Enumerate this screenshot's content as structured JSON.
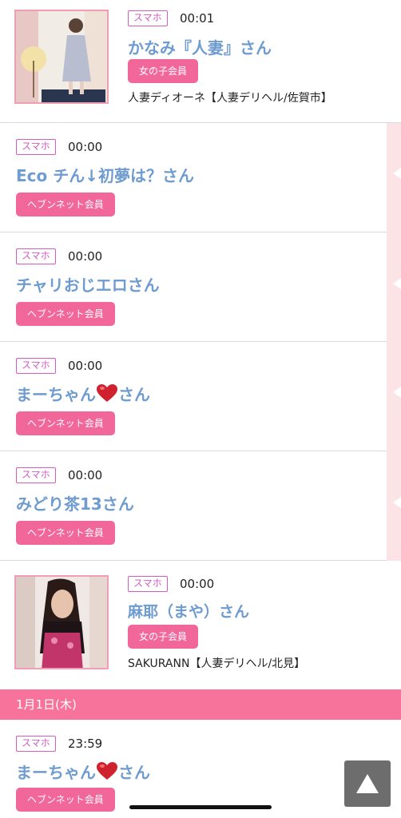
{
  "entries": [
    {
      "device": "スマホ",
      "time": "00:01",
      "name": "かなみ『人妻』さん",
      "badge": "女の子会員",
      "shop": "人妻ディオーネ【人妻デリヘル/佐賀市】",
      "thumb_icon": "woman-photo-icon"
    },
    {
      "device": "スマホ",
      "time": "00:00",
      "name": "Eco チん↓初夢は？さん",
      "badge": "ヘブンネット会員"
    },
    {
      "device": "スマホ",
      "time": "00:00",
      "name": "チャリおじエロさん",
      "badge": "ヘブンネット会員"
    },
    {
      "device": "スマホ",
      "time": "00:00",
      "name_pre": "まーちゃん",
      "name_post": "さん",
      "badge": "ヘブンネット会員",
      "heart_icon": "heart-icon"
    },
    {
      "device": "スマホ",
      "time": "00:00",
      "name": "みどり茶13さん",
      "badge": "ヘブンネット会員"
    },
    {
      "device": "スマホ",
      "time": "00:00",
      "name": "麻耶（まや）さん",
      "badge": "女の子会員",
      "shop": "SAKURANN【人妻デリヘル/北見】",
      "thumb_icon": "woman-photo-icon"
    }
  ],
  "date_header": "1月1日(木)",
  "last_entry": {
    "device": "スマホ",
    "time": "23:59",
    "name_pre": "まーちゃん",
    "name_post": "さん",
    "badge": "ヘブンネット会員"
  },
  "scroll_top_icon": "triangle-up-icon",
  "colors": {
    "accent_pink": "#f2679a",
    "name_blue": "#6e9bd0",
    "tag_magenta": "#d25cc0",
    "date_bar": "#f7739b"
  }
}
